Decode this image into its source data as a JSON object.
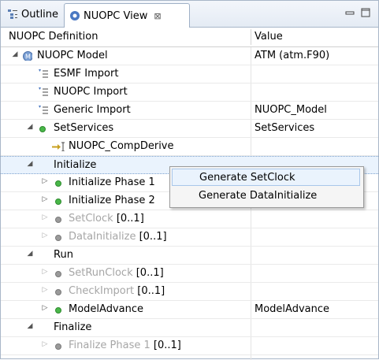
{
  "tabs": [
    {
      "label": "Outline",
      "icon": "outline-icon"
    },
    {
      "label": "NUOPC View",
      "icon": "nuopc-view-icon",
      "close": "⊠"
    }
  ],
  "columns": {
    "definition": "NUOPC Definition",
    "value": "Value"
  },
  "rows": [
    {
      "label": "NUOPC Model",
      "value": "ATM (atm.F90)"
    },
    {
      "label": "ESMF Import",
      "value": ""
    },
    {
      "label": "NUOPC Import",
      "value": ""
    },
    {
      "label": "Generic Import",
      "value": "NUOPC_Model"
    },
    {
      "label": "SetServices",
      "value": "SetServices"
    },
    {
      "label": "NUOPC_CompDerive",
      "value": ""
    },
    {
      "label": "Initialize",
      "value": ""
    },
    {
      "label": "Initialize Phase 1",
      "value": ""
    },
    {
      "label": "Initialize Phase 2",
      "value": ""
    },
    {
      "label": "SetClock",
      "suffix": "[0..1]",
      "value": ""
    },
    {
      "label": "DataInitialize",
      "suffix": "[0..1]",
      "value": ""
    },
    {
      "label": "Run",
      "value": ""
    },
    {
      "label": "SetRunClock",
      "suffix": "[0..1]",
      "value": ""
    },
    {
      "label": "CheckImport",
      "suffix": "[0..1]",
      "value": ""
    },
    {
      "label": "ModelAdvance",
      "value": "ModelAdvance"
    },
    {
      "label": "Finalize",
      "value": ""
    },
    {
      "label": "Finalize Phase 1",
      "suffix": "[0..1]",
      "value": ""
    }
  ],
  "context_menu": [
    "Generate SetClock",
    "Generate DataInitialize"
  ]
}
